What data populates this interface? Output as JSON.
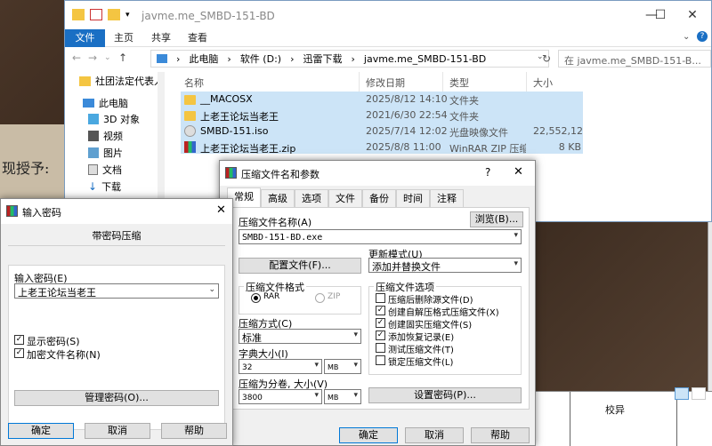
{
  "desktop": {
    "paper_text": "现授予:",
    "doc_text": "校异"
  },
  "explorer": {
    "title": "javme.me_SMBD-151-BD",
    "controls": {
      "minimize": "—",
      "maximize": "☐",
      "close": "✕"
    },
    "ribbon_tabs": [
      "文件",
      "主页",
      "共享",
      "查看"
    ],
    "breadcrumb": [
      "此电脑",
      "软件 (D:)",
      "迅雷下载",
      "javme.me_SMBD-151-BD"
    ],
    "search_placeholder": "在 javme.me_SMBD-151-B...",
    "nav_items": [
      "社团法定代表人",
      "此电脑",
      "3D 对象",
      "视频",
      "图片",
      "文档",
      "下载"
    ],
    "columns": [
      "名称",
      "修改日期",
      "类型",
      "大小"
    ],
    "files": [
      {
        "name": "__MACOSX",
        "date": "2025/8/12 14:10",
        "type": "文件夹",
        "size": "",
        "icon": "folder-icon"
      },
      {
        "name": "上老王论坛当老王",
        "date": "2021/6/30 22:54",
        "type": "文件夹",
        "size": "",
        "icon": "folder-icon"
      },
      {
        "name": "SMBD-151.iso",
        "date": "2025/7/14 12:02",
        "type": "光盘映像文件",
        "size": "22,552,12...",
        "icon": "disc-icon"
      },
      {
        "name": "上老王论坛当老王.zip",
        "date": "2025/8/8 11:00",
        "type": "WinRAR ZIP 压缩...",
        "size": "8 KB",
        "icon": "winrar-icon"
      }
    ]
  },
  "archive": {
    "title": "压缩文件名和参数",
    "help": "?",
    "close": "✕",
    "tabs": [
      "常规",
      "高级",
      "选项",
      "文件",
      "备份",
      "时间",
      "注释"
    ],
    "archive_name_label": "压缩文件名称(A)",
    "browse": "浏览(B)...",
    "archive_name": "SMBD-151-BD.exe",
    "update_mode_label": "更新模式(U)",
    "update_mode": "添加并替换文件",
    "profile_btn": "配置文件(F)...",
    "format_label": "压缩文件格式",
    "format_rar": "RAR",
    "format_zip": "ZIP",
    "options_label": "压缩文件选项",
    "options": [
      {
        "label": "压缩后删除源文件(D)",
        "checked": false
      },
      {
        "label": "创建自解压格式压缩文件(X)",
        "checked": true
      },
      {
        "label": "创建固实压缩文件(S)",
        "checked": true
      },
      {
        "label": "添加恢复记录(E)",
        "checked": true
      },
      {
        "label": "测试压缩文件(T)",
        "checked": false
      },
      {
        "label": "锁定压缩文件(L)",
        "checked": false
      }
    ],
    "method_label": "压缩方式(C)",
    "method": "标准",
    "dict_label": "字典大小(I)",
    "dict": "32",
    "dict_unit": "MB",
    "split_label": "压缩为分卷, 大小(V)",
    "split": "3800",
    "split_unit": "MB",
    "setpwd_btn": "设置密码(P)...",
    "ok": "确定",
    "cancel": "取消",
    "helpbtn": "帮助"
  },
  "pwd": {
    "title": "输入密码",
    "close": "✕",
    "heading": "带密码压缩",
    "input_label": "输入密码(E)",
    "password": "上老王论坛当老王",
    "show_pwd": "显示密码(S)",
    "encrypt_names": "加密文件名称(N)",
    "manage": "管理密码(O)...",
    "ok": "确定",
    "cancel": "取消",
    "help": "帮助"
  }
}
